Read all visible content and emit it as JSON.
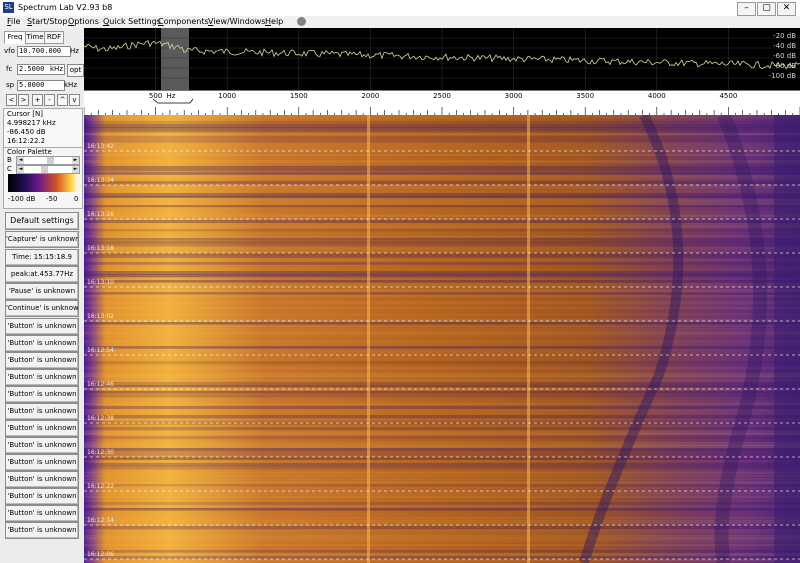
{
  "window": {
    "title": "Spectrum Lab V2.93 b8",
    "app_icon": "SL",
    "buttons": [
      "–",
      "▢",
      "✕"
    ]
  },
  "menu": [
    {
      "label": "File",
      "key": "F",
      "rest": "ile"
    },
    {
      "label": "Start/Stop",
      "key": "S",
      "rest": "tart/Stop"
    },
    {
      "label": "Options",
      "key": "O",
      "rest": "ptions"
    },
    {
      "label": "Quick Settings",
      "key": "Q",
      "rest": "uick Settings"
    },
    {
      "label": "Components",
      "key": "C",
      "rest": "omponents"
    },
    {
      "label": "View/Windows",
      "key": "V",
      "rest": "iew/Windows"
    },
    {
      "label": "Help",
      "key": "H",
      "rest": "elp"
    }
  ],
  "tabs": [
    "Freq",
    "Time",
    "RDF"
  ],
  "freq_panel": {
    "vfo_label": "vfo",
    "vfo_value": "10.700.000",
    "vfo_unit": "Hz",
    "fc_label": "fc",
    "fc_value": "2.5000",
    "fc_unit": "kHz",
    "sp_label": "sp",
    "sp_value": "5.0000",
    "sp_unit": "kHz",
    "opt_label": "opt",
    "nav_buttons": [
      "<",
      ">",
      "+",
      "-",
      "^",
      "v"
    ]
  },
  "cursor": {
    "title": "Cursor [N]",
    "freq": "4.998217 kHz",
    "level": "-86.450 dB",
    "time": "16:12:22.2"
  },
  "palette": {
    "title": "Color Palette",
    "b_label": "B",
    "c_label": "C",
    "min": "-100 dB",
    "mid": "-50",
    "max": "0"
  },
  "buttons": [
    "Default settings",
    "'Capture' is unknown",
    "Time: 15:15:18.9",
    "peak:at.453.77Hz",
    "'Pause' is unknown",
    "'Continue' is unknown",
    "'Button' is unknown",
    "'Button' is unknown",
    "'Button' is unknown",
    "'Button' is unknown",
    "'Button' is unknown",
    "'Button' is unknown",
    "'Button' is unknown",
    "'Button' is unknown",
    "'Button' is unknown",
    "'Button' is unknown",
    "'Button' is unknown",
    "'Button' is unknown",
    "'Button' is unknown"
  ],
  "spectrum": {
    "db_labels": [
      "-20 dB",
      "-40 dB",
      "-60 dB",
      "-80 dB",
      "-100 dB"
    ]
  },
  "scale": {
    "unit": "Hz",
    "labels": [
      "500",
      "1000",
      "1500",
      "2000",
      "2500",
      "3000",
      "3500",
      "4000",
      "4500"
    ]
  },
  "waterfall": {
    "time_labels": [
      "16:13:42",
      "16:13:34",
      "16:13:26",
      "16:13:18",
      "16:13:10",
      "16:13:02",
      "16:12:54",
      "16:12:46",
      "16:12:38",
      "16:12:30",
      "16:12:22",
      "16:12:14",
      "16:12:06"
    ]
  },
  "colors": {
    "accent": "#1f3c88",
    "waterfall_base": "#b36a1a",
    "spectrum_trace": "#d8d8a0"
  }
}
